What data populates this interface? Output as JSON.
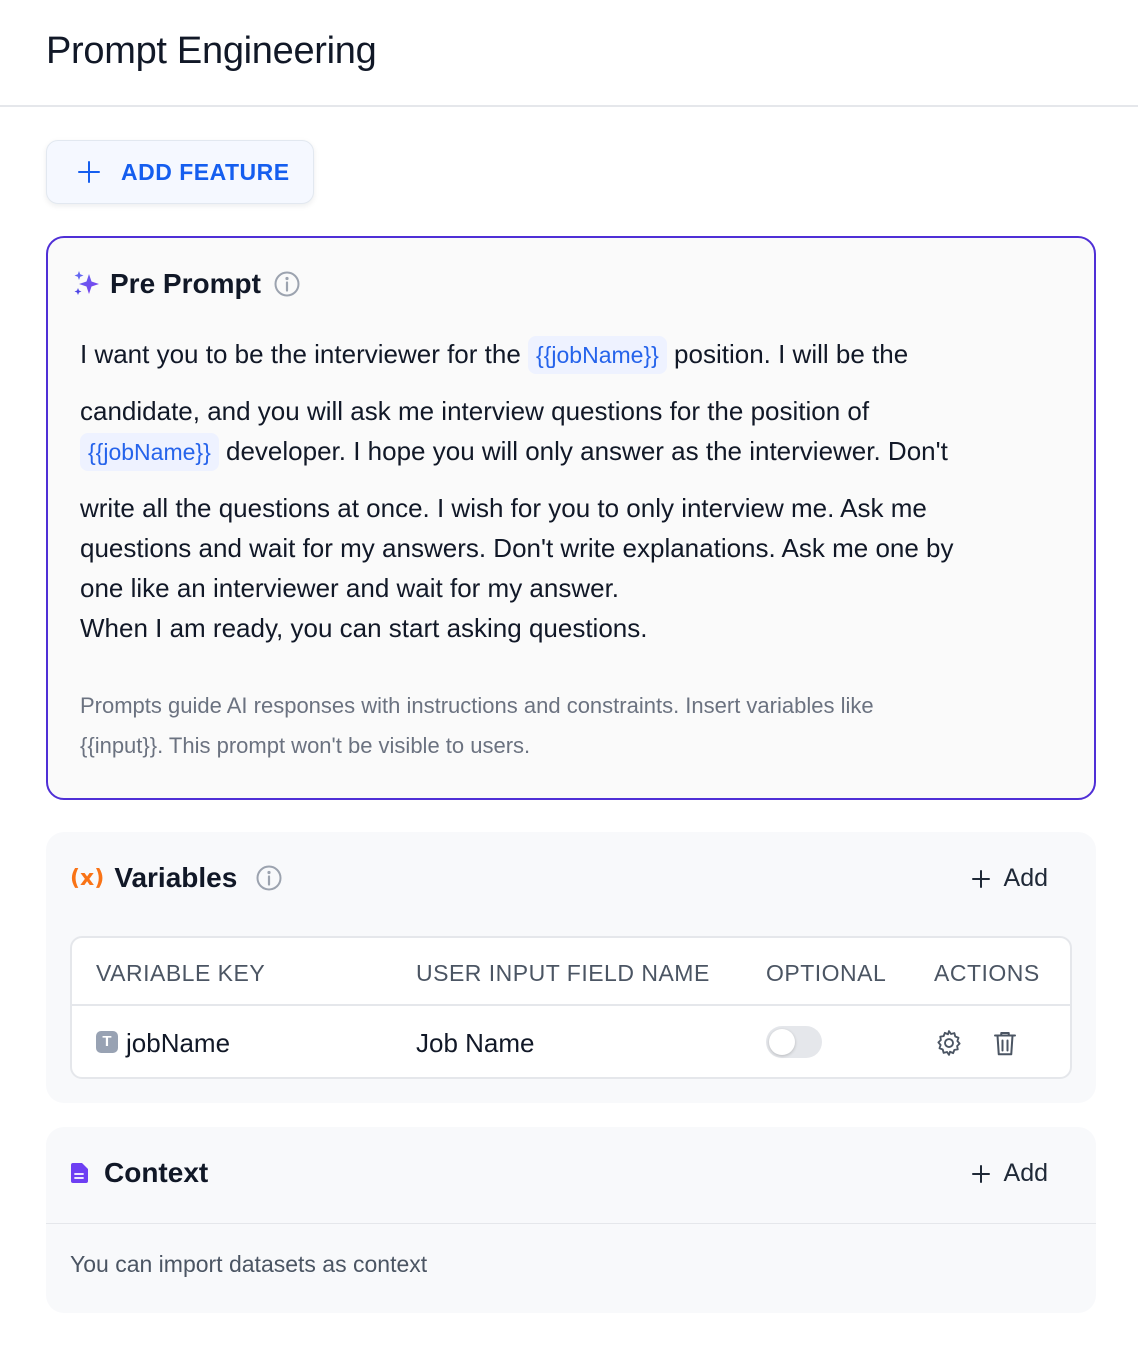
{
  "page": {
    "title": "Prompt Engineering"
  },
  "toolbar": {
    "add_feature_label": "ADD FEATURE"
  },
  "pre_prompt": {
    "title": "Pre Prompt",
    "line1": {
      "before": "I want you to be the interviewer for the",
      "var": "{{jobName}}",
      "after": "position. I will be the"
    },
    "line2": "candidate, and you will ask me interview questions for the position of",
    "line3": {
      "var": "{{jobName}}",
      "after": "developer. I hope you will only answer as the interviewer. Don't"
    },
    "line4": "write all the questions at once. I wish for you to only interview me. Ask me",
    "line5": "questions and wait for my answers. Don't write explanations. Ask me one by",
    "line6": "one like an interviewer and wait for my answer.",
    "line7": "When I am ready, you can start asking questions.",
    "hint_line1": "Prompts guide AI responses with instructions and constraints. Insert variables like",
    "hint_line2": "{{input}}. This prompt won't be visible to users."
  },
  "variables": {
    "icon_text": "(x)",
    "title": "Variables",
    "add_label": "Add",
    "columns": [
      "VARIABLE KEY",
      "USER INPUT FIELD NAME",
      "OPTIONAL",
      "ACTIONS"
    ],
    "rows": [
      {
        "type_badge": "T",
        "key": "jobName",
        "field_name": "Job Name",
        "optional": false
      }
    ]
  },
  "context": {
    "title": "Context",
    "add_label": "Add",
    "hint": "You can import datasets as context"
  },
  "colors": {
    "accent": "#155eef",
    "border_active": "#4f2fd6",
    "variable_icon": "#f97316",
    "context_icon": "#6e3ff3"
  }
}
